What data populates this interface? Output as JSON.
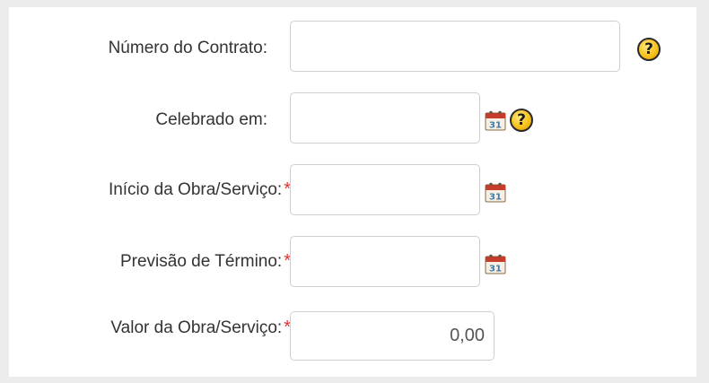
{
  "form": {
    "numero_contrato": {
      "label": "Número do Contrato:",
      "value": "",
      "placeholder": ""
    },
    "celebrado_em": {
      "label": "Celebrado em:",
      "value": "",
      "placeholder": ""
    },
    "inicio_obra": {
      "label": "Início da Obra/Serviço:",
      "required_mark": "*",
      "value": "",
      "placeholder": ""
    },
    "previsao_termino": {
      "label": "Previsão de Término:",
      "required_mark": "*",
      "value": "",
      "placeholder": ""
    },
    "valor_obra": {
      "label": "Valor da Obra/Serviço:",
      "required_mark": "*",
      "value": "0,00",
      "placeholder": ""
    }
  },
  "icons": {
    "help": "help-icon",
    "help_glyph": "?",
    "calendar": "calendar-icon",
    "calendar_day": "31"
  },
  "colors": {
    "required": "#e0332f",
    "help_fill": "#f7c21a",
    "calendar_header": "#c63b2c"
  }
}
